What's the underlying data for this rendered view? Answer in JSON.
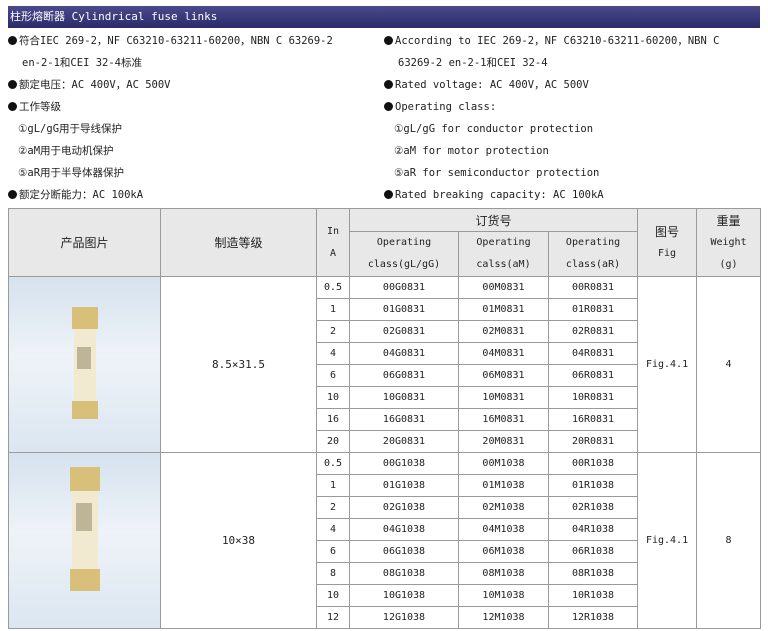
{
  "title": "柱形熔断器 Cylindrical fuse links",
  "spec_left": {
    "l1": "符合IEC 269-2，NF C63210-63211-60200，NBN C 63269-2",
    "l2": "en-2-1和CEI 32-4标准",
    "l3": "额定电压：AC 400V，AC 500V",
    "l4": "工作等级",
    "l5": "①gL/gG用于导线保护",
    "l6": "②aM用于电动机保护",
    "l7": "⑤aR用于半导体器保护",
    "l8": "额定分断能力：AC 100kA"
  },
  "spec_right": {
    "l1": "According to IEC 269-2，NF C63210-63211-60200，NBN C",
    "l2": "63269-2 en-2-1和CEI 32-4",
    "l3": "Rated voltage: AC 400V，AC 500V",
    "l4": "Operating class:",
    "l5": "①gL/gG for conductor protection",
    "l6": "②aM for motor protection",
    "l7": "⑤aR for semiconductor protection",
    "l8": "Rated breaking capacity: AC 100kA"
  },
  "table": {
    "h_image": "产品图片",
    "h_class": "制造等级",
    "h_in1": "In",
    "h_in2": "A",
    "h_order": "订货号",
    "h_op1": "Operating",
    "h_op1b": "class(gL/gG)",
    "h_op2": "Operating",
    "h_op2b": "calss(aM)",
    "h_op3": "Operating",
    "h_op3b": "class(aR)",
    "h_fig1": "图号",
    "h_fig2": "Fig",
    "h_w1": "重量",
    "h_w2": "Weight",
    "h_w3": "(g)",
    "groups": [
      {
        "size": "8.5×31.5",
        "fig": "Fig.4.1",
        "weight": "4",
        "rows": [
          [
            "0.5",
            "00G0831",
            "00M0831",
            "00R0831"
          ],
          [
            "1",
            "01G0831",
            "01M0831",
            "01R0831"
          ],
          [
            "2",
            "02G0831",
            "02M0831",
            "02R0831"
          ],
          [
            "4",
            "04G0831",
            "04M0831",
            "04R0831"
          ],
          [
            "6",
            "06G0831",
            "06M0831",
            "06R0831"
          ],
          [
            "10",
            "10G0831",
            "10M0831",
            "10R0831"
          ],
          [
            "16",
            "16G0831",
            "16M0831",
            "16R0831"
          ],
          [
            "20",
            "20G0831",
            "20M0831",
            "20R0831"
          ]
        ]
      },
      {
        "size": "10×38",
        "fig": "Fig.4.1",
        "weight": "8",
        "rows": [
          [
            "0.5",
            "00G1038",
            "00M1038",
            "00R1038"
          ],
          [
            "1",
            "01G1038",
            "01M1038",
            "01R1038"
          ],
          [
            "2",
            "02G1038",
            "02M1038",
            "02R1038"
          ],
          [
            "4",
            "04G1038",
            "04M1038",
            "04R1038"
          ],
          [
            "6",
            "06G1038",
            "06M1038",
            "06R1038"
          ],
          [
            "8",
            "08G1038",
            "08M1038",
            "08R1038"
          ],
          [
            "10",
            "10G1038",
            "10M1038",
            "10R1038"
          ],
          [
            "12",
            "12G1038",
            "12M1038",
            "12R1038"
          ]
        ]
      }
    ]
  }
}
